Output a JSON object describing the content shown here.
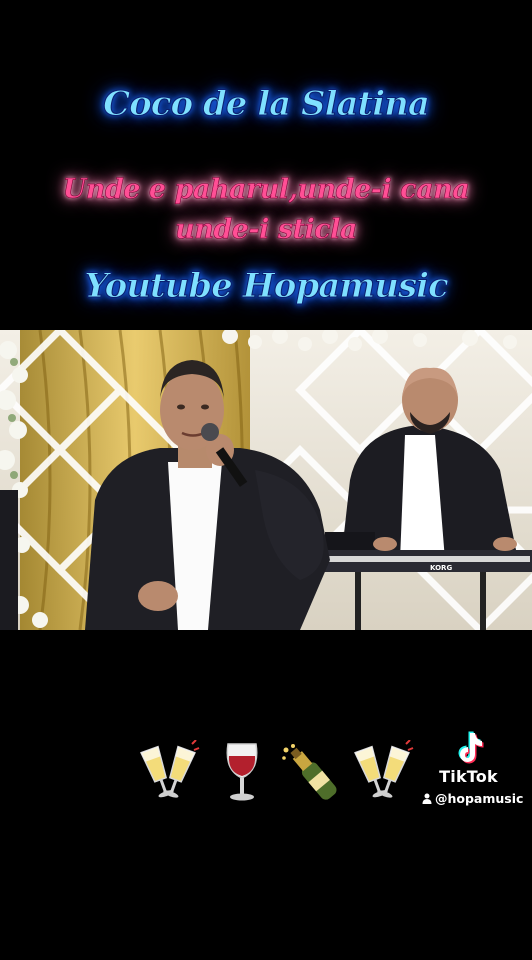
{
  "overlay": {
    "title_line": "Coco de la Slatina",
    "lyric_line1": "Unde e paharul,unde-i cana",
    "lyric_line2": "unde-i sticla",
    "channel_line": "Youtube Hopamusic"
  },
  "video": {
    "keyboard_brand": "KORG",
    "description": "performance frame"
  },
  "emojis": [
    {
      "name": "clinking-glasses-icon"
    },
    {
      "name": "wine-glass-icon"
    },
    {
      "name": "champagne-bottle-icon"
    },
    {
      "name": "clinking-glasses-icon"
    }
  ],
  "watermark": {
    "brand": "TikTok",
    "username": "@hopamusic"
  },
  "colors": {
    "background": "#000000",
    "title_blue": "#7fe0ff",
    "lyric_pink": "#ff4f95"
  }
}
